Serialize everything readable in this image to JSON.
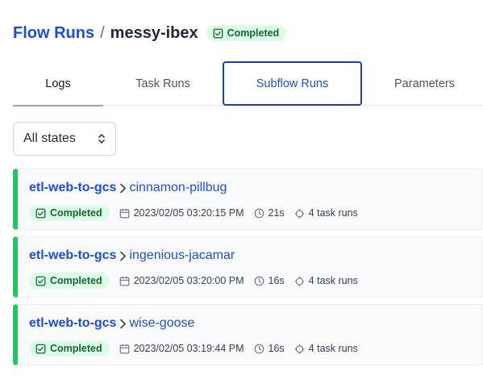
{
  "breadcrumb": {
    "parent": "Flow Runs",
    "separator": "/",
    "current": "messy-ibex",
    "status": "Completed"
  },
  "tabs": [
    {
      "label": "Logs"
    },
    {
      "label": "Task Runs"
    },
    {
      "label": "Subflow Runs"
    },
    {
      "label": "Parameters"
    }
  ],
  "filter": {
    "selected": "All states"
  },
  "runs": [
    {
      "flow": "etl-web-to-gcs",
      "name": "cinnamon-pillbug",
      "status": "Completed",
      "timestamp": "2023/02/05 03:20:15 PM",
      "duration": "21s",
      "task_runs": "4 task runs"
    },
    {
      "flow": "etl-web-to-gcs",
      "name": "ingenious-jacamar",
      "status": "Completed",
      "timestamp": "2023/02/05 03:20:00 PM",
      "duration": "16s",
      "task_runs": "4 task runs"
    },
    {
      "flow": "etl-web-to-gcs",
      "name": "wise-goose",
      "status": "Completed",
      "timestamp": "2023/02/05 03:19:44 PM",
      "duration": "16s",
      "task_runs": "4 task runs"
    }
  ],
  "colors": {
    "accent": "#1d4ed8",
    "success": "#22c55e",
    "success_bg": "#dcfce7",
    "success_text": "#166534",
    "active_tab_border": "#1e40af"
  },
  "icons": {
    "badge": "check-square-icon",
    "date": "calendar-icon",
    "duration": "clock-icon",
    "task_runs": "task-run-icon",
    "select": "chevron-up-down-icon",
    "breadcrumb_child": "chevron-right-icon"
  }
}
